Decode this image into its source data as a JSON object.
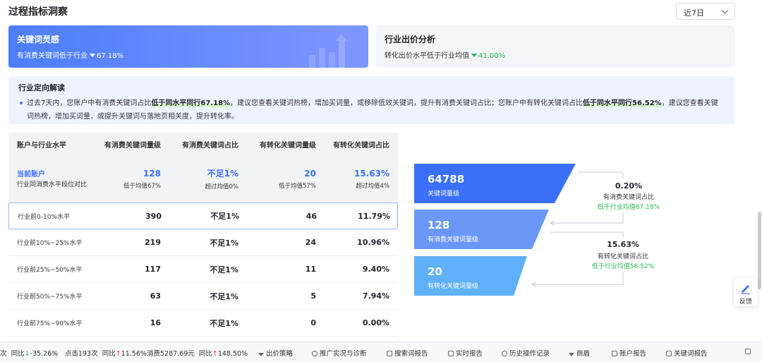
{
  "header": {
    "title": "过程指标洞察",
    "period": "近7日"
  },
  "card_keyword": {
    "title": "关键词灵感",
    "text": "有消费关键词低于行业",
    "value": "67.18%"
  },
  "card_industry": {
    "title": "行业出价分析",
    "text": "转化出价水平低于行业均值",
    "value": "41.00%"
  },
  "interpretation": {
    "title": "行业定向解读",
    "p1": "过去7天内，您账户中有消费关键词占比",
    "h1": "低于同水平同行67.18%",
    "p2": "，建议您查看关键词热榜，增加买词量，或移除低效关键词，提升有消费关键词占比；您账户中有转化关键词占比",
    "h2": "低于同水平同行56.52%",
    "p3": "，建议您查看关键词热榜，增加买词量，或提升关键词与落地页相关度，提升转化率。"
  },
  "table": {
    "headers": [
      "账户与行业水平",
      "有消费关键词量级",
      "有消费关键词占比",
      "有转化关键词量级",
      "有转化关键词占比"
    ],
    "current": {
      "name": "当前账户",
      "desc": "行业同消费水平段位对比",
      "c1": "128",
      "c1s": "低于均值67%",
      "c2": "不足1%",
      "c2s": "超过均值0%",
      "c3": "20",
      "c3s": "低于均值57%",
      "c4": "15.63%",
      "c4s": "超过均值4%"
    },
    "rows": [
      [
        "行业前0-10%水平",
        "390",
        "不足1%",
        "46",
        "11.79%"
      ],
      [
        "行业前10%~25%水平",
        "219",
        "不足1%",
        "24",
        "10.96%"
      ],
      [
        "行业前25%~50%水平",
        "117",
        "不足1%",
        "11",
        "9.40%"
      ],
      [
        "行业前50%~75%水平",
        "63",
        "不足1%",
        "5",
        "7.94%"
      ],
      [
        "行业前75%~90%水平",
        "16",
        "不足1%",
        "0",
        "0.00%"
      ]
    ]
  },
  "funnel": {
    "steps": [
      {
        "value": "64788",
        "label": "关键词量级",
        "color": "#3a6ff8"
      },
      {
        "value": "128",
        "label": "有消费关键词量级",
        "color": "#6b98f7"
      },
      {
        "value": "20",
        "label": "有转化关键词量级",
        "color": "#5fb0f8"
      }
    ],
    "conv1": {
      "pct": "0.20%",
      "label": "有消费关键词占比",
      "note": "低于行业均值67.18%"
    },
    "conv2": {
      "pct": "15.63%",
      "label": "有转化关键词占比",
      "note": "低于行业均值56.52%"
    }
  },
  "feedback": "反馈",
  "bottom": {
    "s1_prefix": "次",
    "s1_label": "同比",
    "s1_val": "-35.26%",
    "s2": "点击193次",
    "s2_label": "同比",
    "s2_val": "11.56%",
    "s3": "消费5287.69元",
    "s3_label": "同比",
    "s3_val": "148.50%",
    "links": [
      "出价策略",
      "推广实况与诊断",
      "搜索词报告",
      "实时报告",
      "历史操作记录",
      "商盾",
      "账户报告",
      "关键词报告"
    ]
  },
  "colors": {
    "accent": "#3a6ff8",
    "green": "#22b84f",
    "red": "#e5432f"
  }
}
